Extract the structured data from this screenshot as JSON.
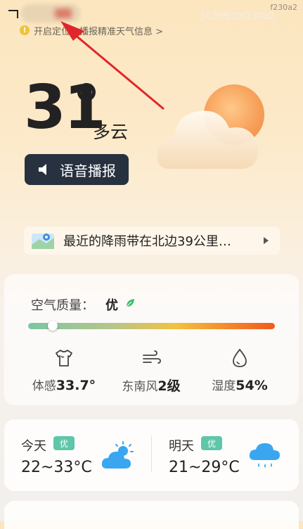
{
  "top": {
    "code": "f230a2",
    "faded_text": "5G预报29f230a2",
    "notice": "开启定位，播报精准天气信息 >"
  },
  "current": {
    "temperature": "31",
    "condition": "多云",
    "voice_button": "语音播报"
  },
  "rain_alert": {
    "text": "最近的降雨带在北边39公里…"
  },
  "air_quality": {
    "label": "空气质量：",
    "value": "优",
    "level_fraction": 0.1,
    "metrics": [
      {
        "label": "体感",
        "value": "33.7°",
        "icon": "tshirt-icon"
      },
      {
        "label": "东南风",
        "value": "2级",
        "icon": "wind-icon"
      },
      {
        "label": "湿度",
        "value": "54%",
        "icon": "humidity-icon"
      }
    ]
  },
  "forecast": [
    {
      "day": "今天",
      "aqi": "优",
      "range": "22~33°C",
      "icon": "partly-cloudy-icon"
    },
    {
      "day": "明天",
      "aqi": "优",
      "range": "21~29°C",
      "icon": "rain-icon"
    }
  ],
  "colors": {
    "badge": "#5fc6a9",
    "forecast_icon": "#3aa6f0",
    "voice_button_bg": "#27313f"
  }
}
